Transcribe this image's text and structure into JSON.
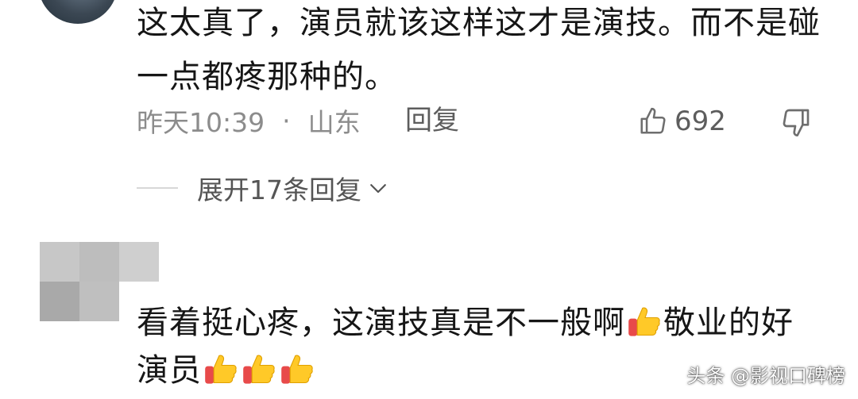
{
  "comment1": {
    "text_line1": "这太真了，演员就该这样这才是演技。而不是碰",
    "text_line2": "一点都疼那种的。",
    "time": "昨天10:39",
    "separator": "·",
    "location": "山东",
    "reply_label": "回复",
    "like_count": "692",
    "like_icon": "thumbs-up-outline-icon",
    "dislike_icon": "thumbs-down-outline-icon",
    "expand_label": "展开17条回复"
  },
  "comment2": {
    "text_part1": "看着挺心疼，这演技真是不一般啊",
    "text_part2": "敬业的好",
    "text_line2": "演员",
    "emoji": "thumbs-up-emoji"
  },
  "watermark": "头条 @影视口碑榜",
  "colors": {
    "meta_gray": "#8c8c8c",
    "text_dark": "#161616",
    "emoji_yellow": "#ffc928",
    "emoji_red": "#e84a4a"
  }
}
